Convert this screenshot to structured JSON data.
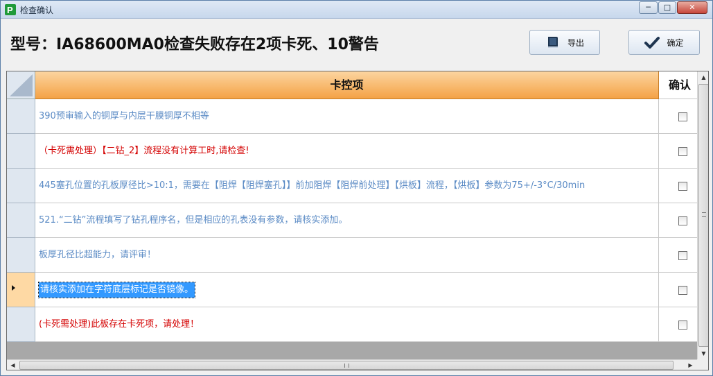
{
  "window": {
    "title": "检查确认",
    "min_icon": "minimize-icon",
    "max_icon": "maximize-icon",
    "close_icon": "close-icon"
  },
  "header": {
    "title": "型号：IA68600MA0检查失败存在2项卡死、10警告"
  },
  "toolbar": {
    "export": {
      "label": "导出",
      "icon": "book-icon"
    },
    "confirm": {
      "label": "确定",
      "icon": "checkmark-icon"
    }
  },
  "grid": {
    "columns": {
      "item": "卡控项",
      "confirm": "确认"
    },
    "rows": [
      {
        "text": "390预审输入的铜厚与内层干膜铜厚不相等",
        "color": "#5b8bc5",
        "checked": false,
        "current": false
      },
      {
        "text": "（卡死需处理）【二钻_2】流程没有计算工时,请检查!",
        "color": "#d40000",
        "checked": false,
        "current": false
      },
      {
        "text": "445塞孔位置的孔板厚径比>10:1，需要在【阻焊【阻焊塞孔】】前加阻焊【阻焊前处理】【烘板】流程，【烘板】参数为75+/-3°C/30min",
        "color": "#5b8bc5",
        "checked": false,
        "current": false
      },
      {
        "text": "521.“二钻”流程填写了钻孔程序名，但是相应的孔表没有参数，请核实添加。",
        "color": "#5b8bc5",
        "checked": false,
        "current": false
      },
      {
        "text": "板厚孔径比超能力，请评审！",
        "color": "#5b8bc5",
        "checked": false,
        "current": false
      },
      {
        "text": "请核实添加在字符底层标记是否镜像。",
        "color": "#5b8bc5",
        "checked": false,
        "current": true
      },
      {
        "text": "(卡死需处理)此板存在卡死项，请处理！",
        "color": "#d40000",
        "checked": false,
        "current": false
      }
    ]
  },
  "colors": {
    "header_orange": "#f4a245",
    "selection": "#3399ff",
    "info_text": "#5b8bc5",
    "error_text": "#d40000"
  }
}
